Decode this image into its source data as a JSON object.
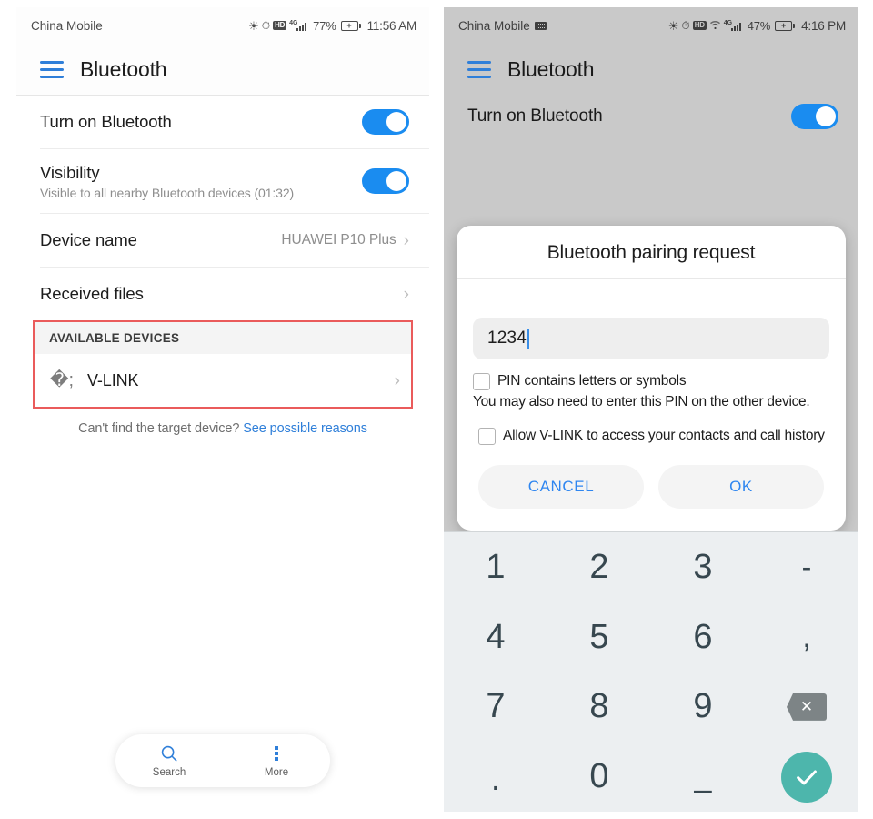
{
  "left_phone": {
    "status_bar": {
      "carrier": "China Mobile",
      "bluetooth_icon": "bluetooth-icon",
      "alarm_icon": "alarm-icon",
      "hd_label": "HD",
      "network_label": "4G",
      "battery_percent": "77%",
      "time": "11:56 AM"
    },
    "app_bar": {
      "menu_icon": "hamburger-menu-icon",
      "title": "Bluetooth"
    },
    "rows": {
      "turn_on": {
        "title": "Turn on Bluetooth",
        "toggle_state": "on"
      },
      "visibility": {
        "title": "Visibility",
        "subtitle": "Visible to all nearby Bluetooth devices (01:32)",
        "toggle_state": "on"
      },
      "device_name": {
        "title": "Device name",
        "value": "HUAWEI P10 Plus"
      },
      "received_files": {
        "title": "Received files"
      }
    },
    "available_devices": {
      "header": "AVAILABLE DEVICES",
      "highlight_color": "#ea5b5b",
      "devices": [
        {
          "name": "V-LINK",
          "icon": "bluetooth-icon"
        }
      ]
    },
    "hint": {
      "text": "Can't find the target device? ",
      "link": "See possible reasons",
      "link_color": "#2f7fd9"
    },
    "dock": {
      "items": [
        {
          "label": "Search",
          "icon": "search-icon"
        },
        {
          "label": "More",
          "icon": "more-vertical-icon"
        }
      ]
    }
  },
  "right_phone": {
    "status_bar": {
      "carrier": "China Mobile",
      "keyboard_icon": "keyboard-icon",
      "bluetooth_icon": "bluetooth-icon",
      "alarm_icon": "alarm-icon",
      "hd_label": "HD",
      "wifi_icon": "wifi-icon",
      "network_label": "4G",
      "battery_percent": "47%",
      "time": "4:16 PM"
    },
    "app_bar": {
      "menu_icon": "hamburger-menu-icon",
      "title": "Bluetooth"
    },
    "background_row": {
      "title": "Turn on Bluetooth",
      "toggle_state": "on"
    },
    "dialog": {
      "title": "Bluetooth pairing request",
      "pin_value": "1234",
      "pin_placeholder": "",
      "checkbox_pin_symbols": {
        "label": "PIN contains letters or symbols",
        "checked": false
      },
      "note": "You may also need to enter this PIN on the other device.",
      "checkbox_allow_contacts": {
        "label": "Allow V-LINK to access your contacts and call history",
        "checked": false
      },
      "cancel_label": "CANCEL",
      "ok_label": "OK",
      "button_text_color": "#2f86f0"
    },
    "keypad": {
      "background_color": "#eceff1",
      "keys": [
        {
          "label": "1",
          "type": "digit"
        },
        {
          "label": "2",
          "type": "digit"
        },
        {
          "label": "3",
          "type": "digit"
        },
        {
          "label": "-",
          "type": "symbol"
        },
        {
          "label": "4",
          "type": "digit"
        },
        {
          "label": "5",
          "type": "digit"
        },
        {
          "label": "6",
          "type": "digit"
        },
        {
          "label": ",",
          "type": "symbol"
        },
        {
          "label": "7",
          "type": "digit"
        },
        {
          "label": "8",
          "type": "digit"
        },
        {
          "label": "9",
          "type": "digit"
        },
        {
          "label": "",
          "type": "backspace",
          "icon": "backspace-icon"
        },
        {
          "label": ".",
          "type": "symbol"
        },
        {
          "label": "0",
          "type": "digit"
        },
        {
          "label": "_",
          "type": "symbol"
        },
        {
          "label": "",
          "type": "enter",
          "icon": "check-icon"
        }
      ],
      "enter_color": "#4db6ac",
      "backspace_color": "#7d8486"
    }
  }
}
